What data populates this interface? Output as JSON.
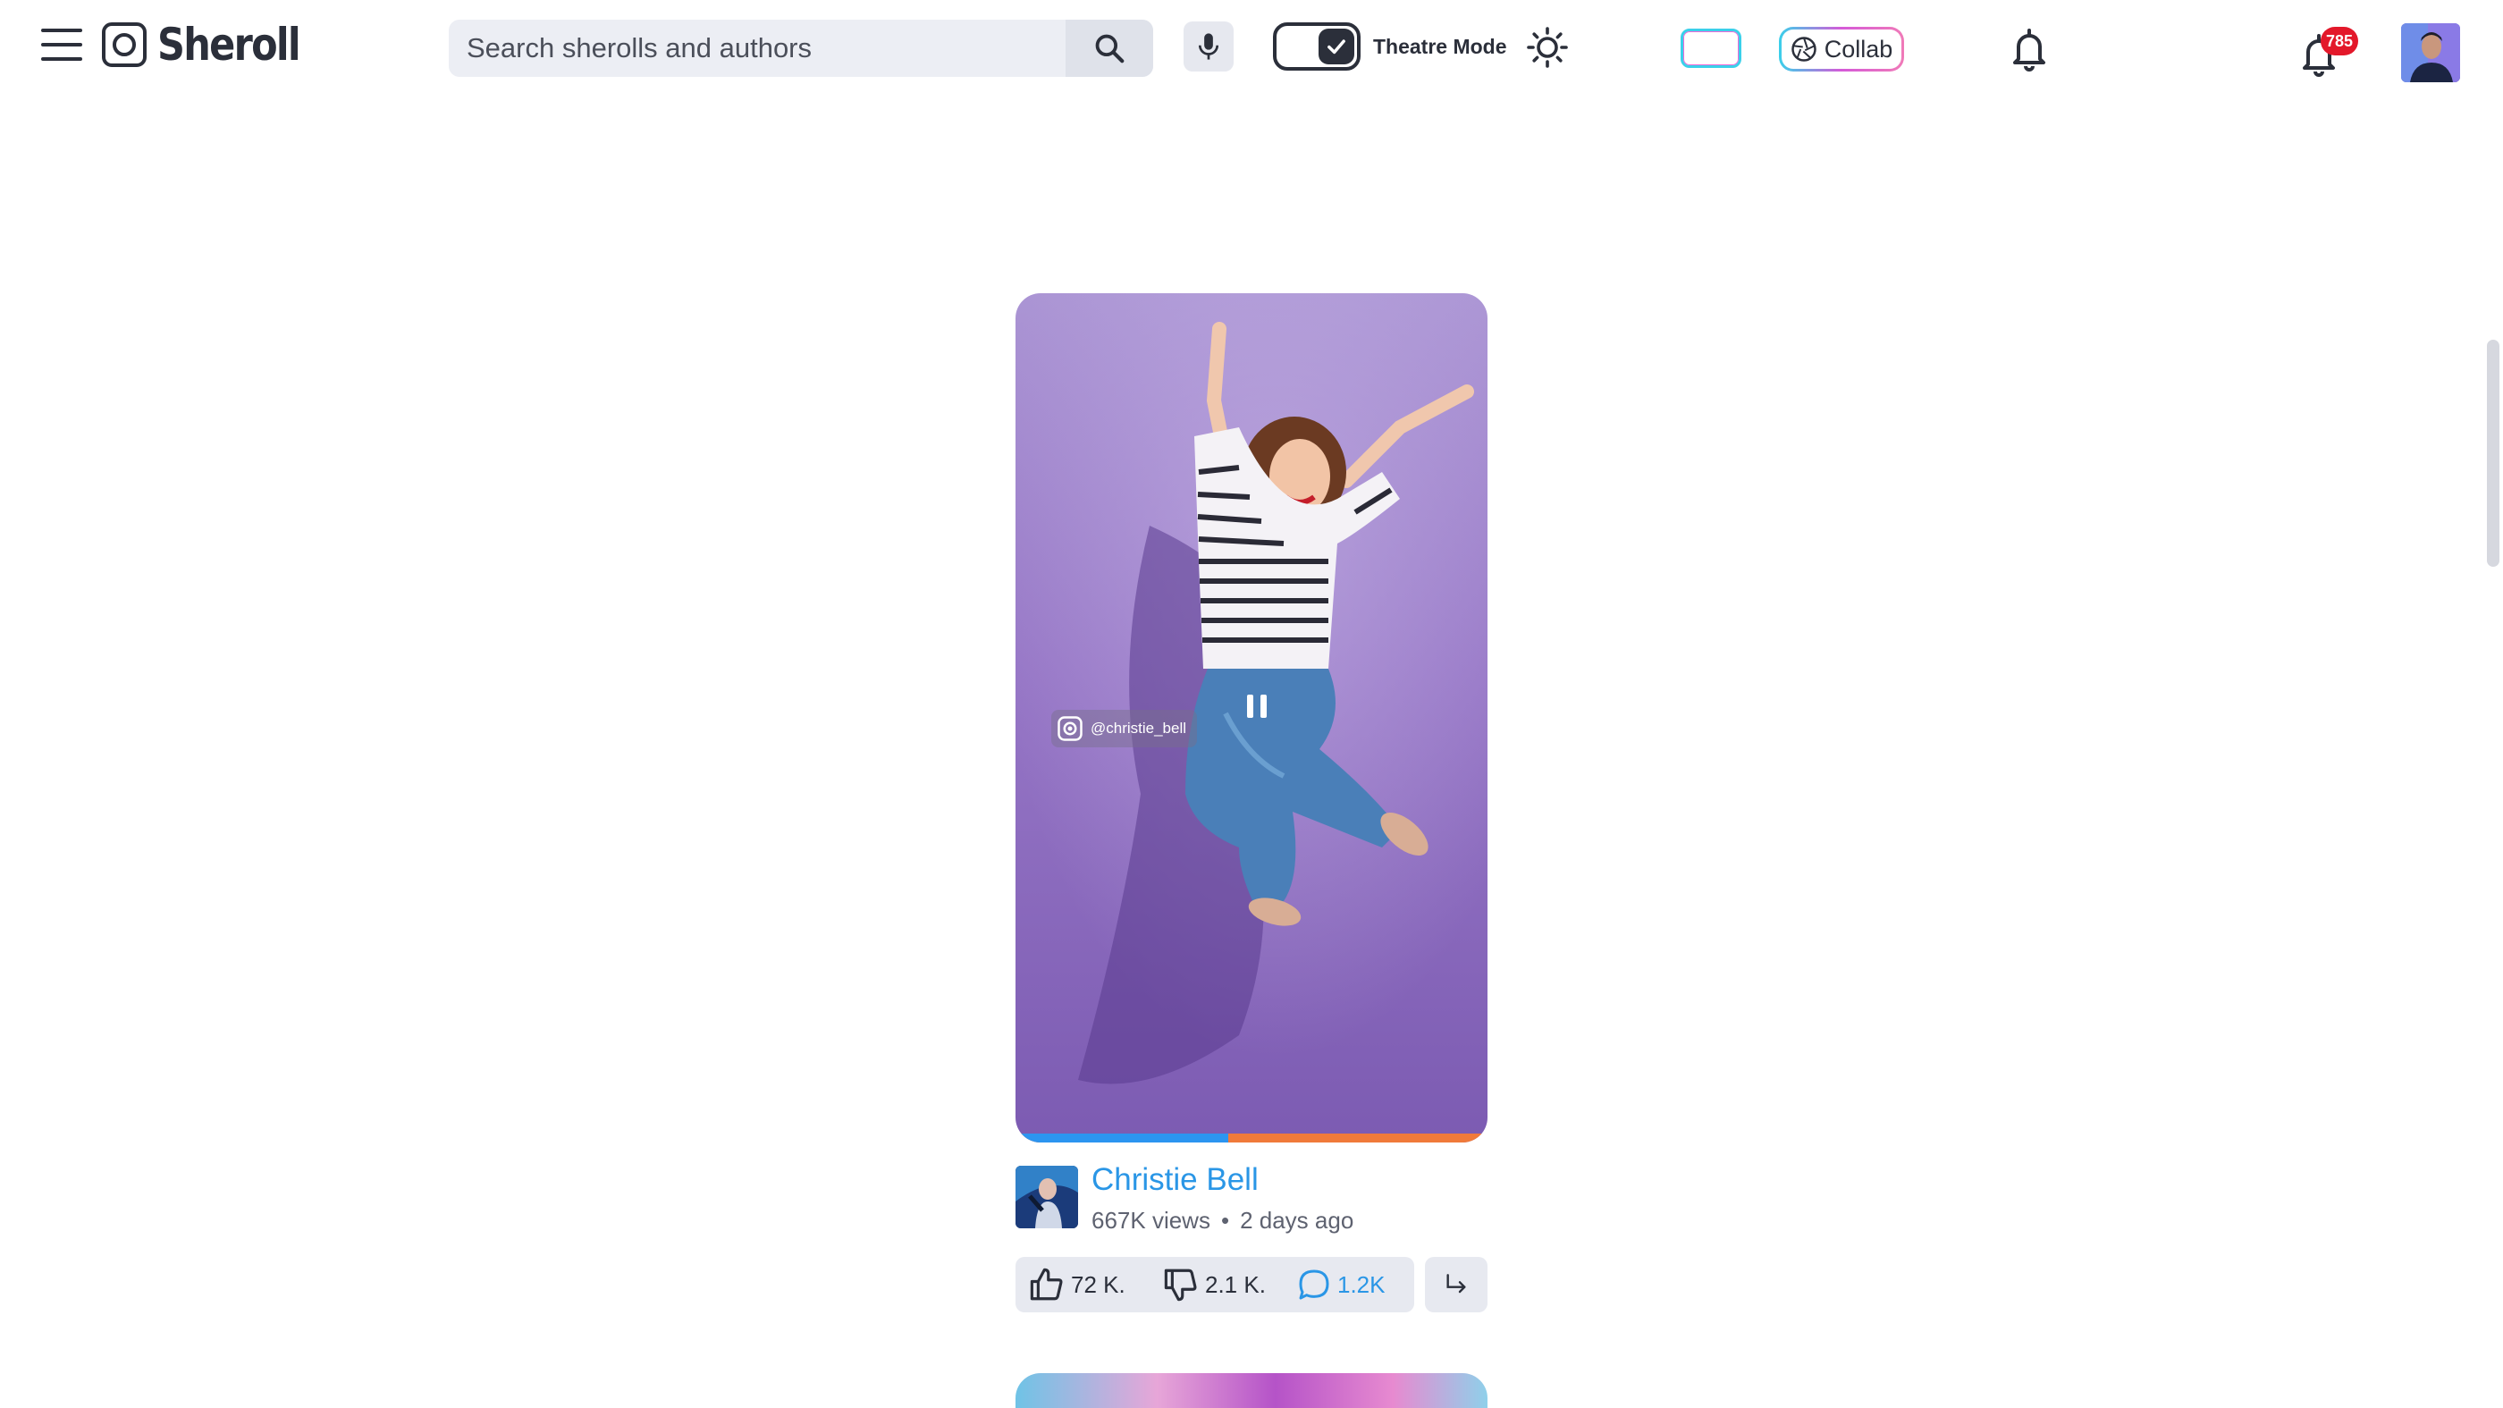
{
  "header": {
    "brand": "Sheroll",
    "search_placeholder": "Search sherolls and authors",
    "theatre_label": "Theatre Mode",
    "theatre_on": true,
    "collab_label": "Collab",
    "notification_count": "785"
  },
  "video": {
    "handle": "@christie_bell",
    "progress": 0.45,
    "state": "playing"
  },
  "author": {
    "name": "Christie Bell",
    "views": "667K views",
    "separator": "•",
    "posted": "2 days ago"
  },
  "actions": {
    "likes": "72 K.",
    "dislikes": "2.1 K.",
    "comments": "1.2K"
  },
  "colors": {
    "accent_blue": "#2a96e6",
    "progress_played": "#2c95f0",
    "progress_remaining": "#f07a3a",
    "badge_red": "#e3182a"
  },
  "icons": [
    "menu-icon",
    "logo-icon",
    "search-icon",
    "microphone-icon",
    "check-icon",
    "sun-icon",
    "plus-icon",
    "aperture-icon",
    "bell-icon",
    "thumbs-up-icon",
    "thumbs-down-icon",
    "comment-icon",
    "share-icon",
    "pause-icon"
  ]
}
